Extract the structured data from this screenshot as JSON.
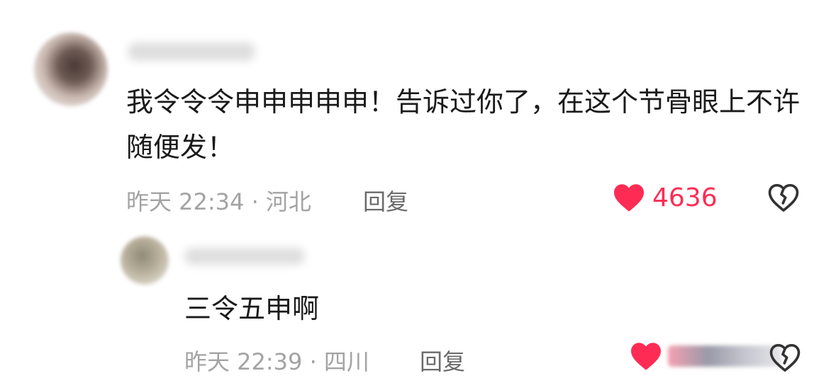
{
  "comment": {
    "text": "我令令令申申申申申！告诉过你了，在这个节骨眼上不许随便发！",
    "meta": "昨天 22:34 · 河北",
    "reply_label": "回复",
    "likes": "4636"
  },
  "reply": {
    "text": "三令五申啊",
    "meta": "昨天 22:39 · 四川",
    "reply_label": "回复"
  },
  "icons": {
    "like": "heart-icon",
    "dislike": "broken-heart-icon"
  },
  "colors": {
    "like": "#fe2c55",
    "text": "#1a1a1a",
    "meta": "#a3a3a3"
  }
}
